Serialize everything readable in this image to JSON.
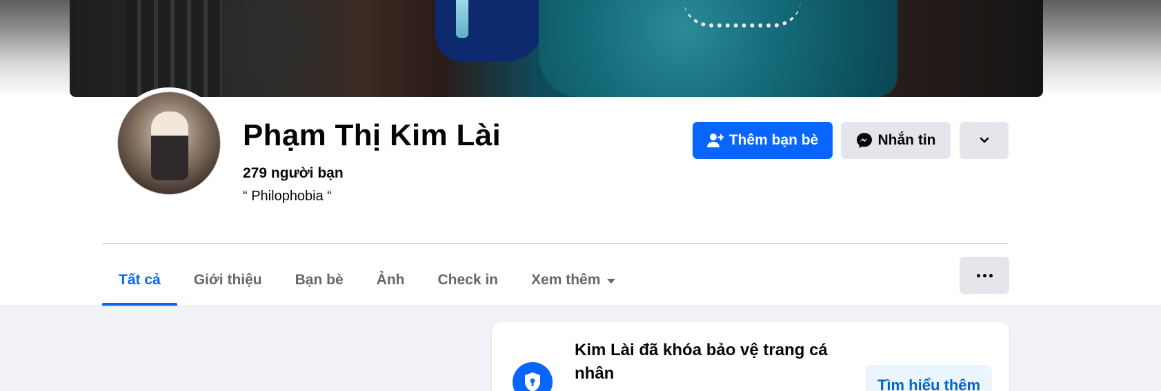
{
  "profile": {
    "name": "Phạm Thị Kim Lài",
    "friends": "279 người bạn",
    "bio": "“ Philophobia “"
  },
  "actions": {
    "add_friend": "Thêm bạn bè",
    "message": "Nhắn tin"
  },
  "tabs": [
    {
      "label": "Tất cả",
      "active": true
    },
    {
      "label": "Giới thiệu",
      "active": false
    },
    {
      "label": "Bạn bè",
      "active": false
    },
    {
      "label": "Ảnh",
      "active": false
    },
    {
      "label": "Check in",
      "active": false
    },
    {
      "label": "Xem thêm",
      "active": false
    }
  ],
  "lock_card": {
    "title": "Kim Lài đã khóa bảo vệ trang cá nhân",
    "button": "Tìm hiểu thêm"
  },
  "icons": {
    "add_friend": "person-plus-icon",
    "message": "messenger-icon",
    "more": "chevron-down-icon",
    "tab_more": "ellipsis-icon",
    "lock": "shield-lock-icon"
  },
  "colors": {
    "accent": "#0866ff",
    "secondary_button": "#e4e6eb",
    "background": "#f0f2f5"
  }
}
